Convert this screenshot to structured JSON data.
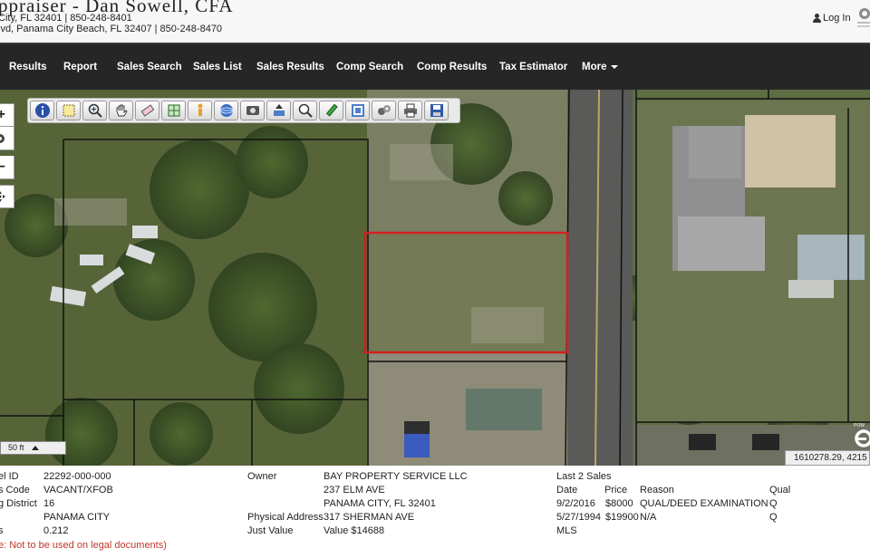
{
  "header": {
    "title": "ppraiser - Dan Sowell, CFA",
    "address_line1": "City, FL 32401 | 850-248-8401",
    "address_line2": "lvd, Panama City Beach, FL 32407 | 850-248-8470",
    "login_label": "Log In"
  },
  "nav": {
    "items": [
      "Results",
      "Report",
      "Sales Search",
      "Sales List",
      "Sales Results",
      "Comp Search",
      "Comp Results",
      "Tax Estimator"
    ],
    "more_label": "More"
  },
  "map": {
    "tools": [
      "info-icon",
      "select-icon",
      "zoom-area-icon",
      "pan-hand-icon",
      "eraser-icon",
      "measure-icon",
      "street-view-icon",
      "globe-icon",
      "photo-icon",
      "buffer-icon",
      "magnify-icon",
      "pencil-icon",
      "print-icon",
      "settings-icon",
      "printer-icon",
      "save-icon"
    ],
    "zoom_in": "+",
    "zoom_out": "−",
    "scale_label": "50 ft",
    "coordinates": "1610278.29, 4215",
    "parcel_color": "#d11f1f"
  },
  "details": {
    "labels": {
      "parcel_id": "el ID",
      "use_code": "s Code",
      "tax_district": "g District",
      "city": "",
      "acres": "s"
    },
    "values": {
      "parcel_id": "22292-000-000",
      "use_code": "VACANT/XFOB",
      "tax_district": "16",
      "city": "PANAMA CITY",
      "acres": "0.212"
    },
    "disclaimer": "e: Not to be used on legal documents)",
    "owner_label": "Owner",
    "owner_name": "BAY PROPERTY SERVICE LLC",
    "owner_street": "237 ELM AVE",
    "owner_city": "PANAMA CITY, FL 32401",
    "physical_address_label": "Physical Address",
    "physical_address": "317 SHERMAN AVE",
    "just_value_label": "Just Value",
    "just_value": "Value $14688",
    "sales": {
      "title": "Last 2 Sales",
      "headers": [
        "Date",
        "Price",
        "Reason",
        "Qual"
      ],
      "rows": [
        {
          "date": "9/2/2016",
          "price": "$8000",
          "reason": "QUAL/DEED EXAMINATION",
          "qual": "Q"
        },
        {
          "date": "5/27/1994",
          "price": "$19900",
          "reason": "N/A",
          "qual": "Q"
        }
      ],
      "mls_label": "MLS"
    }
  }
}
